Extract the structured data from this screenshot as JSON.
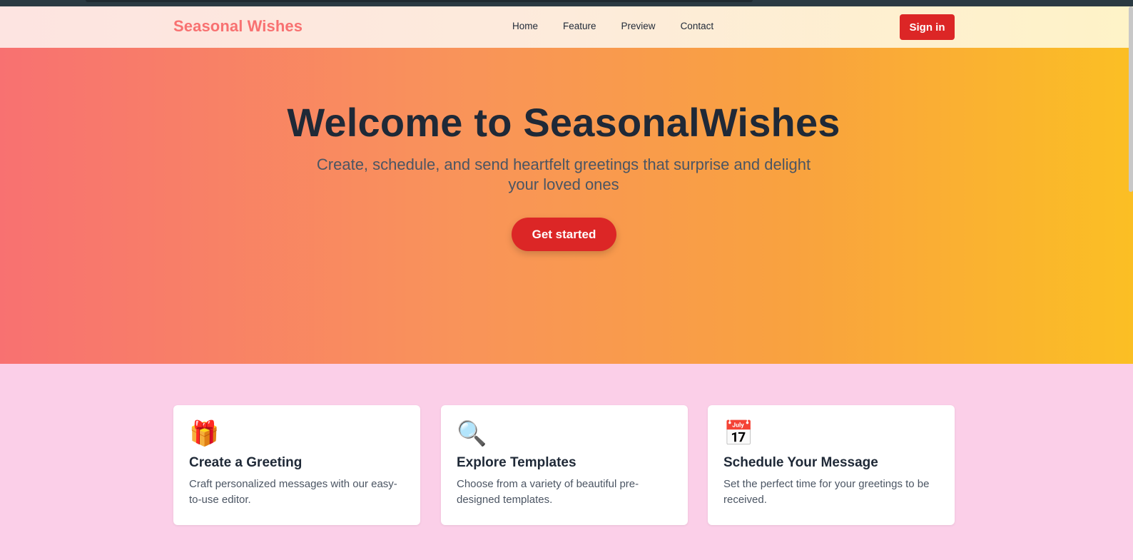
{
  "brand": "Seasonal Wishes",
  "nav": [
    "Home",
    "Feature",
    "Preview",
    "Contact"
  ],
  "signin_label": "Sign in",
  "hero": {
    "title": "Welcome to SeasonalWishes",
    "subtitle": "Create, schedule, and send heartfelt greetings that surprise and delight your loved ones",
    "cta_label": "Get started"
  },
  "features": [
    {
      "icon": "🎁",
      "title": "Create a Greeting",
      "desc": "Craft personalized messages with our easy-to-use editor."
    },
    {
      "icon": "🔍",
      "title": "Explore Templates",
      "desc": "Choose from a variety of beautiful pre-designed templates."
    },
    {
      "icon": "📅",
      "title": "Schedule Your Message",
      "desc": "Set the perfect time for your greetings to be received."
    }
  ],
  "colors": {
    "accent": "#dc2626",
    "brand": "#f87171",
    "section_bg": "#fbcfe8"
  }
}
